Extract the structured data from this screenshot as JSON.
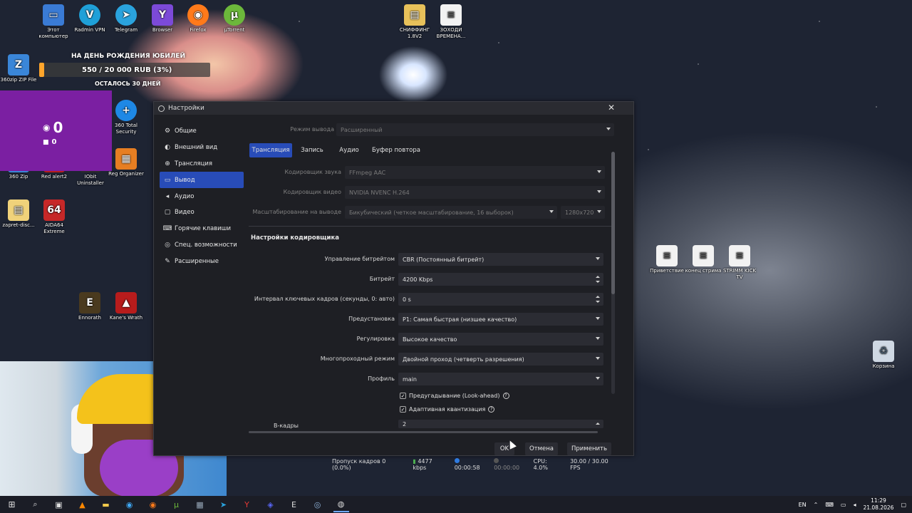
{
  "desktop": {
    "icons_left": [
      {
        "label": "Этот компьютер",
        "icon": "computer-icon",
        "color": "#3a7bd5"
      },
      {
        "label": "Radmin VPN",
        "icon": "vpn-icon",
        "color": "#1fa0d8"
      },
      {
        "label": "Telegram",
        "icon": "telegram-icon",
        "color": "#2aa3de"
      },
      {
        "label": "Browser",
        "icon": "browser-icon",
        "color": "#7c4ad8"
      },
      {
        "label": "Firefox",
        "icon": "firefox-icon",
        "color": "#ff7a1a"
      },
      {
        "label": "µTorrent",
        "icon": "utorrent-icon",
        "color": "#6cb83b"
      }
    ],
    "icons_col1": [
      {
        "label": "360zip ZIP File",
        "icon": "zip-icon"
      },
      {
        "label": "360 Zip",
        "icon": "zip-icon"
      },
      {
        "label": "zapret-disc...",
        "icon": "file-icon"
      },
      {
        "label": "Ennorath",
        "icon": "ennorath-icon"
      }
    ],
    "icons_col2": [
      {
        "label": "Red alert2",
        "icon": "game-icon"
      },
      {
        "label": "IObit Uninstaller",
        "icon": "uninstaller-icon"
      },
      {
        "label": "AIDA64 Extreme",
        "icon": "aida64-icon"
      },
      {
        "label": "Kane's Wrath",
        "icon": "game-icon"
      }
    ],
    "icons_col3": [
      {
        "label": "360 Total Security",
        "icon": "security-icon"
      },
      {
        "label": "Reg Organizer",
        "icon": "registry-icon"
      }
    ],
    "icons_top_right": [
      {
        "label": "СНИФФИНГ 1.8V2",
        "icon": "folder-icon"
      },
      {
        "label": "ЗОХОДИ ВРЕМЕНА...",
        "icon": "document-icon"
      }
    ],
    "icons_right": [
      {
        "label": "Приветствие",
        "icon": "document-icon"
      },
      {
        "label": "конец стрима",
        "icon": "document-icon"
      },
      {
        "label": "STRIMM KICK TV",
        "icon": "document-icon"
      }
    ],
    "recycle_bin": "Корзина",
    "aida_badge": "64"
  },
  "overlay": {
    "donation_title": "НА ДЕНЬ РОЖДЕНИЯ ЮБИЛЕЙ",
    "donation_amount": "550 / 20 000 RUB (3%)",
    "donation_progress": 0.03,
    "donation_remaining": "ОСТАЛОСЬ 30 ДНЕЙ",
    "viewers_count": "0",
    "followers_count": "0"
  },
  "dialog": {
    "title": "Настройки",
    "sidebar": [
      {
        "label": "Общие",
        "icon": "gear-icon",
        "active": false
      },
      {
        "label": "Внешний вид",
        "icon": "palette-icon",
        "active": false
      },
      {
        "label": "Трансляция",
        "icon": "globe-icon",
        "active": false
      },
      {
        "label": "Вывод",
        "icon": "output-icon",
        "active": true
      },
      {
        "label": "Аудио",
        "icon": "speaker-icon",
        "active": false
      },
      {
        "label": "Видео",
        "icon": "monitor-icon",
        "active": false
      },
      {
        "label": "Горячие клавиши",
        "icon": "keyboard-icon",
        "active": false
      },
      {
        "label": "Спец. возможности",
        "icon": "accessibility-icon",
        "active": false
      },
      {
        "label": "Расширенные",
        "icon": "tools-icon",
        "active": false
      }
    ],
    "output_mode_label": "Режим вывода",
    "output_mode_value": "Расширенный",
    "tabs": [
      "Трансляция",
      "Запись",
      "Аудио",
      "Буфер повтора"
    ],
    "audio_encoder_label": "Кодировщик звука",
    "audio_encoder_value": "FFmpeg AAC",
    "video_encoder_label": "Кодировщик видео",
    "video_encoder_value": "NVIDIA NVENC H.264",
    "rescale_label": "Масштабирование на выводе",
    "rescale_value": "Бикубический (четкое масштабирование, 16 выборок)",
    "rescale_res": "1280x720",
    "encoder_section": "Настройки кодировщика",
    "rate_control_label": "Управление битрейтом",
    "rate_control_value": "CBR (Постоянный битрейт)",
    "bitrate_label": "Битрейт",
    "bitrate_value": "4200 Kbps",
    "keyframe_label": "Интервал ключевых кадров (секунды, 0: авто)",
    "keyframe_value": "0 s",
    "preset_label": "Предустановка",
    "preset_value": "P1: Самая быстрая (низшее качество)",
    "tuning_label": "Регулировка",
    "tuning_value": "Высокое качество",
    "multipass_label": "Многопроходный режим",
    "multipass_value": "Двойной проход (четверть разрешения)",
    "profile_label": "Профиль",
    "profile_value": "main",
    "lookahead_label": "Предугадывание (Look-ahead)",
    "aq_label": "Адаптивная квантизация",
    "bframes_label": "B-кадры",
    "bframes_value": "2",
    "ok_label": "OK",
    "cancel_label": "Отмена",
    "apply_label": "Применить"
  },
  "statusbar": {
    "dropped": "Пропуск кадров 0 (0.0%)",
    "kbps": "4477 kbps",
    "stream_time": "00:00:58",
    "rec_time": "00:00:00",
    "cpu": "CPU: 4.0%",
    "fps": "30.00 / 30.00 FPS"
  },
  "taskbar": {
    "lang": "EN",
    "time": "11:29",
    "date": "21.08.2026"
  },
  "colors": {
    "accent": "#284cb8",
    "dialog_bg": "#1e1f24",
    "donation_fill": "#ffa52b",
    "viewer_panel": "#7b1fa2"
  }
}
